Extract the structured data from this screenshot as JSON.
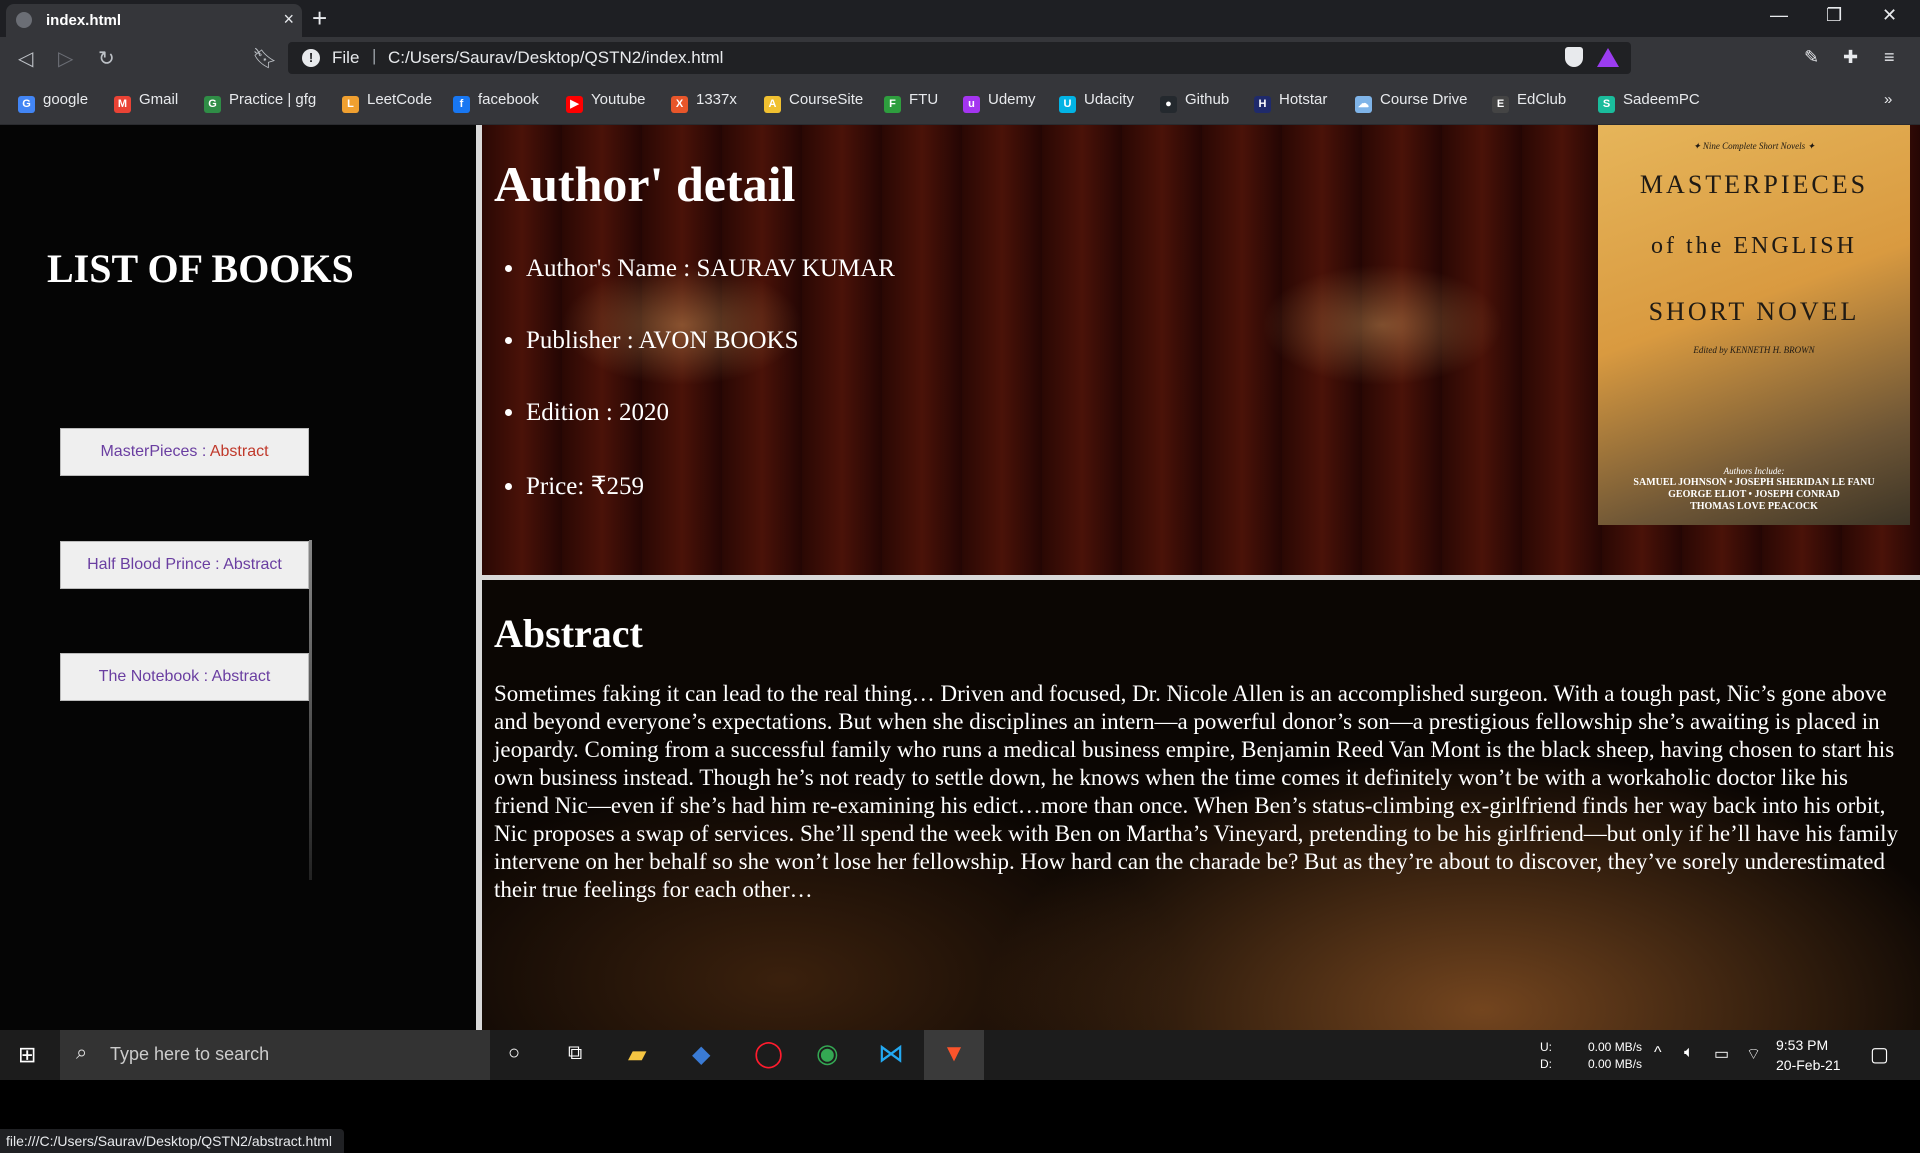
{
  "browser": {
    "tab_title": "index.html",
    "close": "×",
    "new_tab": "+",
    "url_scheme": "File",
    "url_path": "C:/Users/Saurav/Desktop/QSTN2/index.html",
    "status_url": "file:///C:/Users/Saurav/Desktop/QSTN2/abstract.html"
  },
  "bookmarks": [
    {
      "label": "google",
      "color": "#4285f4",
      "glyph": "G"
    },
    {
      "label": "Gmail",
      "color": "#ea4335",
      "glyph": "M"
    },
    {
      "label": "Practice | gfg",
      "color": "#2f8d46",
      "glyph": "G"
    },
    {
      "label": "LeetCode",
      "color": "#f0a030",
      "glyph": "L"
    },
    {
      "label": "facebook",
      "color": "#1877f2",
      "glyph": "f"
    },
    {
      "label": "Youtube",
      "color": "#ff0000",
      "glyph": "▶"
    },
    {
      "label": "1337x",
      "color": "#e8562a",
      "glyph": "X"
    },
    {
      "label": "CourseSite",
      "color": "#f0c030",
      "glyph": "A"
    },
    {
      "label": "FTU",
      "color": "#2e9e3e",
      "glyph": "F"
    },
    {
      "label": "Udemy",
      "color": "#a435f0",
      "glyph": "u"
    },
    {
      "label": "Udacity",
      "color": "#02b3e4",
      "glyph": "U"
    },
    {
      "label": "Github",
      "color": "#24292e",
      "glyph": "●"
    },
    {
      "label": "Hotstar",
      "color": "#1f2a6b",
      "glyph": "H"
    },
    {
      "label": "Course Drive",
      "color": "#7fb4e8",
      "glyph": "☁"
    },
    {
      "label": "EdClub",
      "color": "#444444",
      "glyph": "E"
    },
    {
      "label": "SadeemPC",
      "color": "#1abc9c",
      "glyph": "S"
    }
  ],
  "sidebar": {
    "title": "LIST OF BOOKS",
    "books": [
      {
        "name": "MasterPieces",
        "sep": " : ",
        "link": "Abstract"
      },
      {
        "name": "Half Blood Prince",
        "sep": " : ",
        "link": "Abstract"
      },
      {
        "name": "The Notebook",
        "sep": " : ",
        "link": "Abstract"
      }
    ]
  },
  "detail": {
    "heading": "Author' detail",
    "items": [
      "Author's Name : SAURAV KUMAR",
      "Publisher : AVON BOOKS",
      "Edition : 2020",
      "Price: ₹259"
    ],
    "cover": {
      "top_line": "✦ Nine Complete Short Novels ✦",
      "title1": "MASTERPIECES",
      "title2": "of the ENGLISH",
      "title3": "SHORT NOVEL",
      "editor": "Edited by KENNETH H. BROWN",
      "authors_label": "Authors Include:",
      "authors1": "SAMUEL JOHNSON • JOSEPH SHERIDAN LE FANU",
      "authors2": "GEORGE ELIOT • JOSEPH CONRAD",
      "authors3": "THOMAS LOVE PEACOCK"
    }
  },
  "abstract": {
    "heading": "Abstract",
    "text": "Sometimes faking it can lead to the real thing… Driven and focused, Dr. Nicole Allen is an accomplished surgeon. With a tough past, Nic’s gone above and beyond everyone’s expectations. But when she disciplines an intern—a powerful donor’s son—a prestigious fellowship she’s awaiting is placed in jeopardy. Coming from a successful family who runs a medical business empire, Benjamin Reed Van Mont is the black sheep, having chosen to start his own business instead. Though he’s not ready to settle down, he knows when the time comes it definitely won’t be with a workaholic doctor like his friend Nic—even if she’s had him re-examining his edict…more than once. When Ben’s status-climbing ex-girlfriend finds her way back into his orbit, Nic proposes a swap of services. She’ll spend the week with Ben on Martha’s Vineyard, pretending to be his girlfriend—but only if he’ll have his family intervene on her behalf so she won’t lose her fellowship. How hard can the charade be? But as they’re about to discover, they’ve sorely underestimated their true feelings for each other…"
  },
  "taskbar": {
    "search_placeholder": "Type here to search",
    "net_u_label": "U:",
    "net_d_label": "D:",
    "net_up": "0.00 MB/s",
    "net_down": "0.00 MB/s",
    "time": "9:53 PM",
    "date": "20-Feb-21"
  }
}
